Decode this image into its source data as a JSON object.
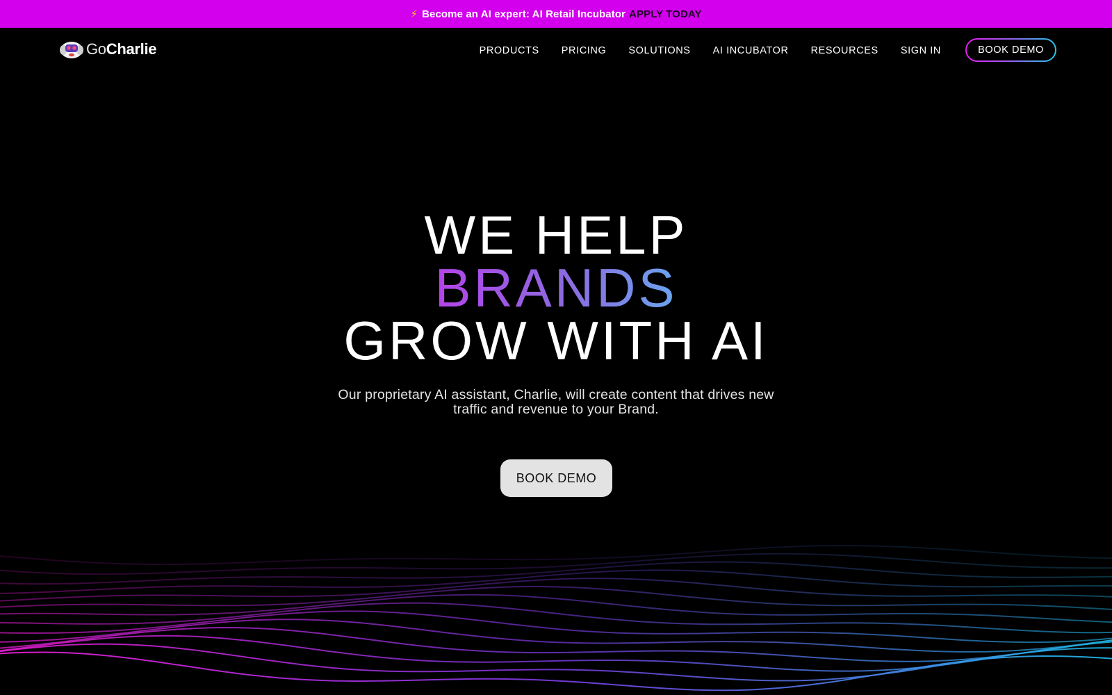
{
  "promo": {
    "icon": "lightning-bolt-icon",
    "text": "Become an AI expert: AI Retail Incubator",
    "cta": "APPLY TODAY"
  },
  "nav": {
    "logo": {
      "go": "Go",
      "charlie": "Charlie",
      "icon": "robot-mascot-icon"
    },
    "links": [
      "PRODUCTS",
      "PRICING",
      "SOLUTIONS",
      "AI INCUBATOR",
      "RESOURCES",
      "SIGN IN"
    ],
    "book_demo": "BOOK DEMO"
  },
  "hero": {
    "line1": "WE HELP",
    "line2": "BRANDS",
    "line3": "GROW WITH AI",
    "subtitle": "Our proprietary AI assistant, Charlie, will create content that drives new traffic and revenue to your Brand.",
    "cta": "BOOK DEMO"
  },
  "colors": {
    "promo_bg": "#d200ec",
    "accent_magenta": "#e81cf0",
    "accent_blue": "#22c7e8",
    "cta_bg": "#e3e3e3"
  }
}
